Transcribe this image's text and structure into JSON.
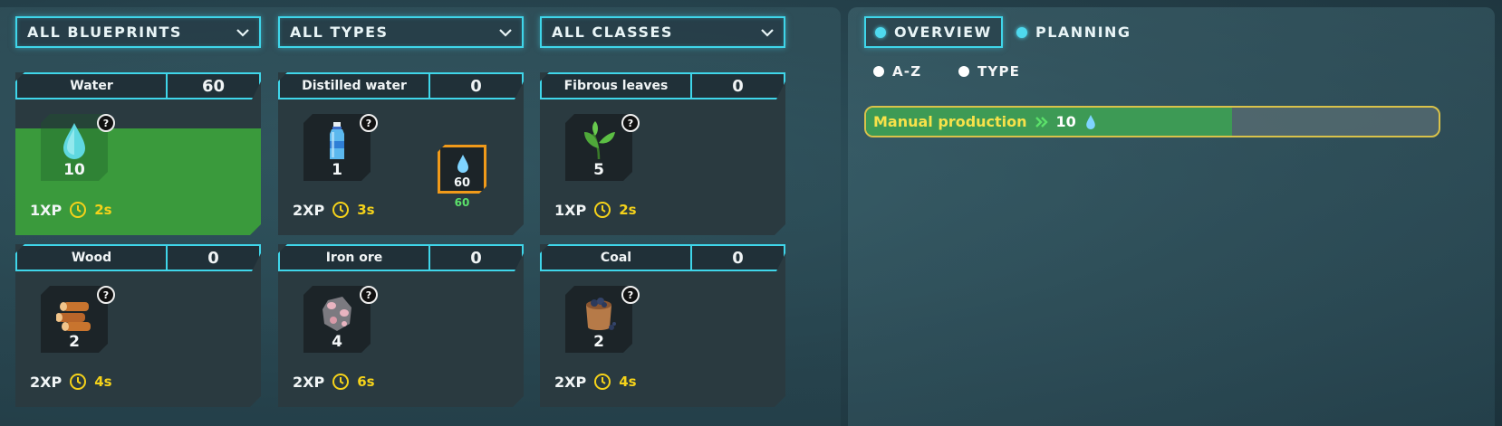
{
  "filters": {
    "blueprints": "ALL BLUEPRINTS",
    "types": "ALL TYPES",
    "classes": "ALL CLASSES"
  },
  "blueprints": [
    {
      "name": "Water",
      "count": "60",
      "icon": "water-drop-icon",
      "qty": "10",
      "xp": "1XP",
      "time": "2s",
      "active": true
    },
    {
      "name": "Distilled water",
      "count": "0",
      "icon": "water-bottle-icon",
      "qty": "1",
      "xp": "2XP",
      "time": "3s",
      "input": {
        "icon": "water-drop-icon",
        "qty": "60",
        "available": "60"
      }
    },
    {
      "name": "Fibrous leaves",
      "count": "0",
      "icon": "leaves-icon",
      "qty": "5",
      "xp": "1XP",
      "time": "2s"
    },
    {
      "name": "Wood",
      "count": "0",
      "icon": "logs-icon",
      "qty": "2",
      "xp": "2XP",
      "time": "4s"
    },
    {
      "name": "Iron ore",
      "count": "0",
      "icon": "iron-ore-icon",
      "qty": "4",
      "xp": "2XP",
      "time": "6s"
    },
    {
      "name": "Coal",
      "count": "0",
      "icon": "coal-sack-icon",
      "qty": "2",
      "xp": "2XP",
      "time": "4s"
    }
  ],
  "help_symbol": "?",
  "tabs": {
    "overview": "OVERVIEW",
    "planning": "PLANNING",
    "selected": "overview"
  },
  "sort": {
    "az": "A-Z",
    "type": "TYPE"
  },
  "production": {
    "label": "Manual production",
    "value": "10",
    "icon": "water-drop-icon",
    "progress": 0.64
  },
  "colors": {
    "accent": "#3fd6ea",
    "active_green": "#3a9a3c",
    "time_yellow": "#f5d21a",
    "highlight_orange": "#f09a1a"
  }
}
